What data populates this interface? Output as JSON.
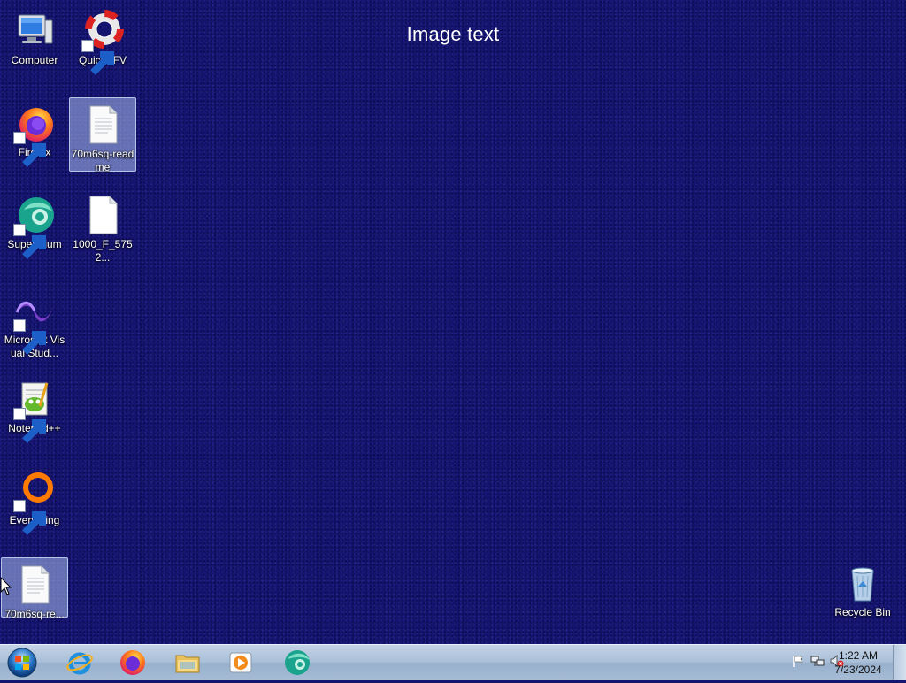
{
  "desktop": {
    "banner_text": "Image text",
    "icons": [
      {
        "label": "Computer",
        "icon": "computer-icon",
        "shortcut": false
      },
      {
        "label": "QuickSFV",
        "icon": "lifebuoy-icon",
        "shortcut": true
      },
      {
        "label": "Firefox",
        "icon": "firefox-icon",
        "shortcut": true
      },
      {
        "label": "70m6sq-readme",
        "icon": "text-file-icon",
        "shortcut": false,
        "selected": true
      },
      {
        "label": "Supermium",
        "icon": "supermium-icon",
        "shortcut": true
      },
      {
        "label": "1000_F_5752...",
        "icon": "file-icon",
        "shortcut": false
      },
      {
        "label": "Microsoft Visual Stud...",
        "icon": "visual-studio-icon",
        "shortcut": true
      },
      {
        "label": "Notepad++",
        "icon": "notepad-plus-plus-icon",
        "shortcut": true
      },
      {
        "label": "Everything",
        "icon": "everything-search-icon",
        "shortcut": true
      },
      {
        "label": "70m6sq-re...",
        "icon": "text-file-icon",
        "shortcut": false,
        "selected": true
      },
      {
        "label": "Recycle Bin",
        "icon": "recycle-bin-icon",
        "shortcut": false
      }
    ]
  },
  "taskbar": {
    "start_icon": "windows-start-icon",
    "pinned": [
      {
        "name": "Internet Explorer",
        "icon": "internet-explorer-icon"
      },
      {
        "name": "Firefox",
        "icon": "firefox-icon"
      },
      {
        "name": "File Explorer",
        "icon": "folder-icon"
      },
      {
        "name": "Media Player",
        "icon": "media-player-icon"
      },
      {
        "name": "Supermium",
        "icon": "supermium-icon"
      }
    ],
    "tray_icons": [
      "flag-icon",
      "network-icon",
      "volume-muted-icon"
    ],
    "clock": {
      "time": "1:22 AM",
      "date": "7/23/2024"
    }
  },
  "colors": {
    "desktop_bg": "#15146f",
    "taskbar_bg": "#a9bfd8",
    "selection": "#aabef0"
  }
}
